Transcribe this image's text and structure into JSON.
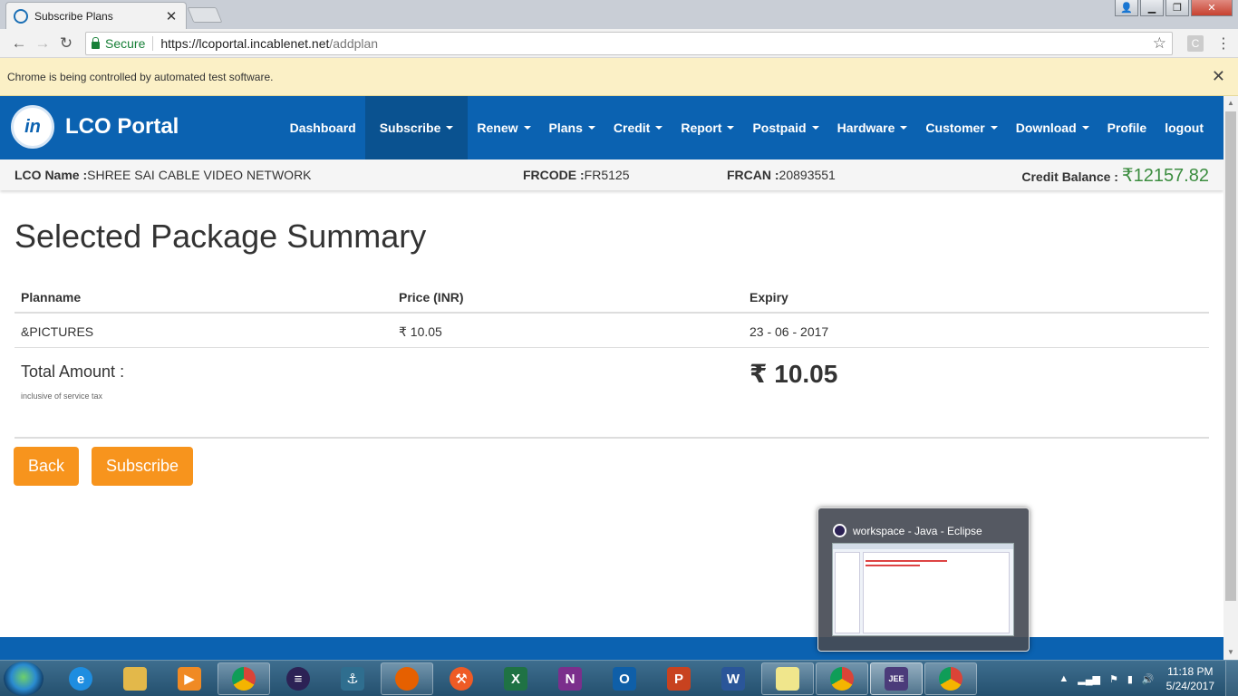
{
  "browser": {
    "tab_title": "Subscribe Plans",
    "secure_label": "Secure",
    "url_scheme_host": "https://lcoportal.incablenet.net",
    "url_path": "/addplan",
    "infobar_text": "Chrome is being controlled by automated test software."
  },
  "portal": {
    "brand_name": "LCO Portal",
    "nav": [
      {
        "label": "Dashboard",
        "dropdown": false
      },
      {
        "label": "Subscribe",
        "dropdown": true
      },
      {
        "label": "Renew",
        "dropdown": true
      },
      {
        "label": "Plans",
        "dropdown": true
      },
      {
        "label": "Credit",
        "dropdown": true
      },
      {
        "label": "Report",
        "dropdown": true
      },
      {
        "label": "Postpaid",
        "dropdown": true
      },
      {
        "label": "Hardware",
        "dropdown": true
      },
      {
        "label": "Customer",
        "dropdown": true
      },
      {
        "label": "Download",
        "dropdown": true
      },
      {
        "label": "Profile",
        "dropdown": false
      },
      {
        "label": "logout",
        "dropdown": false
      }
    ],
    "active_nav": "Subscribe",
    "info": {
      "lco_label": "LCO Name :",
      "lco_value": "SHREE SAI CABLE VIDEO NETWORK",
      "frcode_label": "FRCODE :",
      "frcode_value": "FR5125",
      "frcan_label": "FRCAN :",
      "frcan_value": "20893551",
      "credit_label": "Credit Balance : ",
      "credit_value": "₹12157.82"
    }
  },
  "summary": {
    "heading": "Selected Package Summary",
    "columns": [
      "Planname",
      "Price (INR)",
      "Expiry"
    ],
    "rows": [
      {
        "planname": "&PICTURES",
        "price": "₹ 10.05",
        "expiry": "23 - 06 - 2017"
      }
    ],
    "total_label": "Total Amount :",
    "total_note": "inclusive of service tax",
    "total_amount": "₹ 10.05"
  },
  "buttons": {
    "back": "Back",
    "subscribe": "Subscribe"
  },
  "thumbnail": {
    "title": "workspace - Java - Eclipse"
  },
  "taskbar": {
    "apps": [
      "internet-explorer-icon",
      "file-explorer-icon",
      "media-player-icon",
      "chrome-icon",
      "eclipse-icon",
      "mysql-workbench-icon",
      "firefox-icon",
      "postman-icon",
      "excel-icon",
      "onenote-icon",
      "outlook-icon",
      "powerpoint-icon",
      "word-icon",
      "sticky-notes-icon",
      "chrome-icon",
      "eclipse-java-ee-icon",
      "chrome-icon"
    ],
    "time": "11:18 PM",
    "date": "5/24/2017"
  },
  "colors": {
    "navbar": "#0b62b1",
    "button": "#f7941d",
    "credit": "#3c8d40"
  }
}
